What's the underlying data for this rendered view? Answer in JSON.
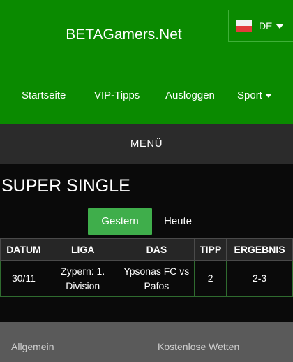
{
  "header": {
    "brand": "BETAGamers.Net",
    "language": "DE",
    "nav": [
      "Startseite",
      "VIP-Tipps",
      "Ausloggen",
      "Sport"
    ]
  },
  "menu": {
    "label": "MENÜ"
  },
  "main": {
    "title": "SUPER SINGLE",
    "tabs": [
      "Gestern",
      "Heute"
    ],
    "active_tab": "Gestern",
    "table": {
      "headers": [
        "DATUM",
        "LIGA",
        "DAS",
        "TIPP",
        "ERGEBNIS"
      ],
      "rows": [
        [
          "30/11",
          "Zypern: 1. Division",
          "Ypsonas FC vs Pafos",
          "2",
          "2-3"
        ]
      ]
    }
  },
  "footer": {
    "links": [
      "Allgemein",
      "Kostenlose Wetten"
    ]
  },
  "colors": {
    "header_green": "#0a8a00",
    "tab_active": "#3fae4b",
    "menubar": "#2b2b2b"
  }
}
